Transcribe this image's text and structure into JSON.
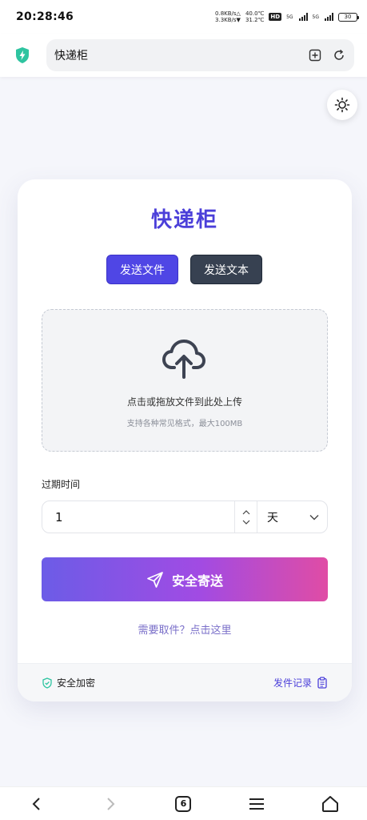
{
  "status_bar": {
    "time": "20:28:46",
    "net_up": "0.8KB/s△",
    "net_down": "3.3KB/s▼",
    "temp_1": "40.0℃",
    "temp_2": "31.2℃",
    "hd": "HD",
    "sig_label_1": "5G",
    "sig_label_2": "5G",
    "battery": "30"
  },
  "browser": {
    "url_title": "快递柜",
    "bookmark_icon": "bookmark-add-icon",
    "refresh_icon": "refresh-icon",
    "logo_icon": "shield-bolt-icon"
  },
  "theme_toggle": {
    "icon": "sun-icon"
  },
  "card": {
    "title": "快递柜",
    "tabs": [
      {
        "label": "发送文件",
        "active": true
      },
      {
        "label": "发送文本",
        "active": false
      }
    ],
    "upload": {
      "icon": "cloud-upload-icon",
      "main_text": "点击或拖放文件到此处上传",
      "sub_text": "支持各种常见格式，最大100MB"
    },
    "expire": {
      "label": "过期时间",
      "value": "1",
      "unit": "天"
    },
    "send_button": {
      "label": "安全寄送",
      "icon": "send-icon"
    },
    "pickup_link": "需要取件？点击这里",
    "footer": {
      "left_label": "安全加密",
      "left_icon": "shield-check-icon",
      "right_label": "发件记录",
      "right_icon": "clipboard-icon"
    }
  },
  "bottom_nav": {
    "tab_count": "6"
  },
  "colors": {
    "accent": "#4f46e5",
    "title": "#4b3fd9",
    "dark_tab": "#374151",
    "gradient_start": "#6c5ce7",
    "gradient_end": "#e04ca5",
    "logo": "#2ec4a0"
  }
}
